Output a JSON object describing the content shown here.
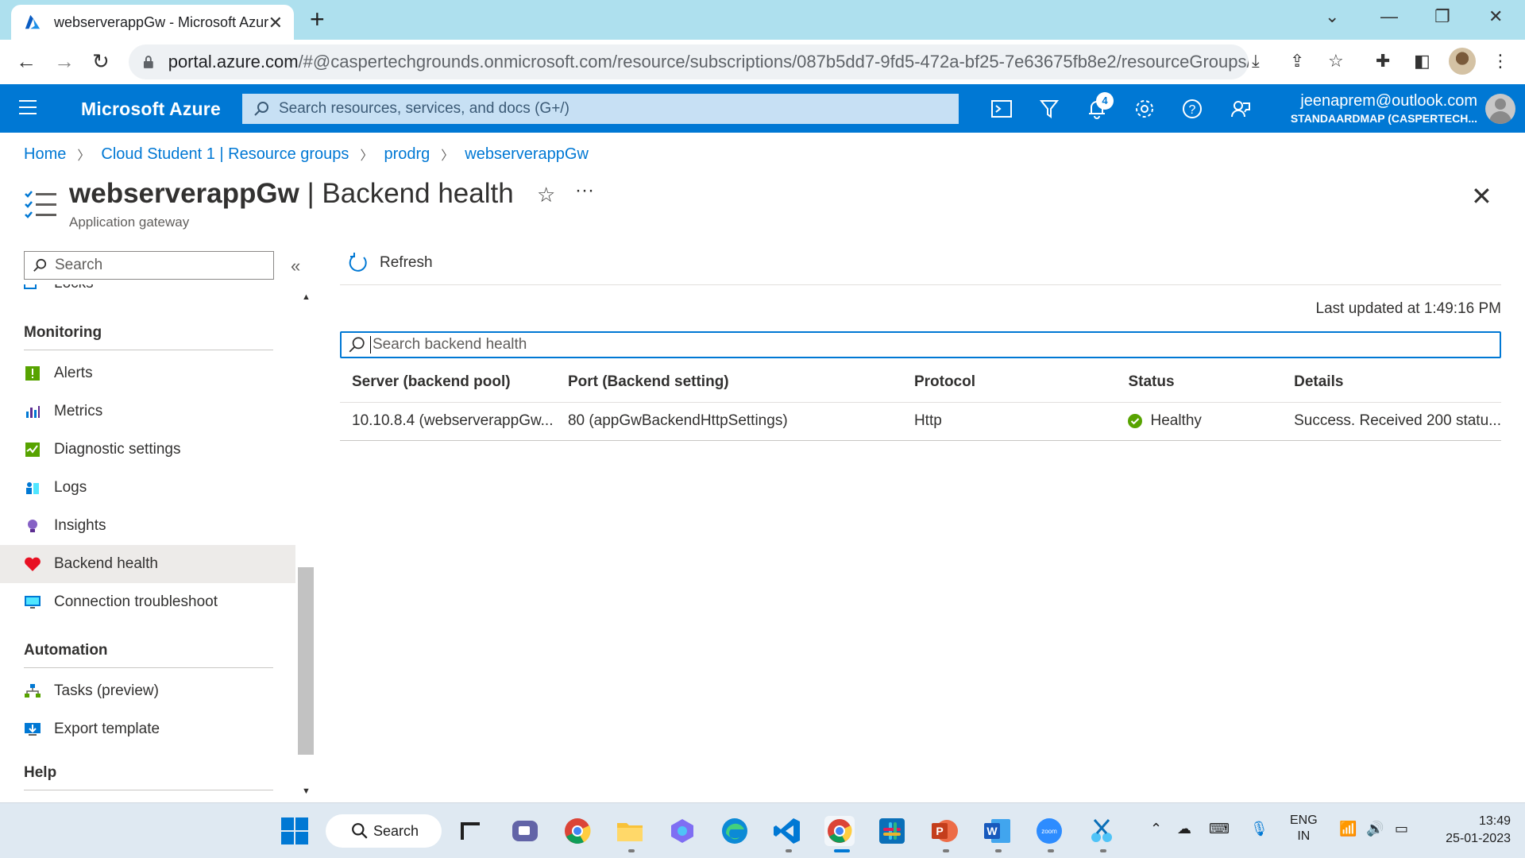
{
  "browser": {
    "tab_title": "webserverappGw - Microsoft Azure",
    "url_host": "portal.azure.com",
    "url_rest": "/#@caspertechgrounds.onmicrosoft.com/resource/subscriptions/087b5dd7-9fd5-472a-bf25-7e63675fb8e2/resourceGroups/pr..."
  },
  "azure": {
    "brand": "Microsoft Azure",
    "search_placeholder": "Search resources, services, and docs (G+/)",
    "notifications_count": "4",
    "user_email": "jeenaprem@outlook.com",
    "user_tenant": "STANDAARDMAP (CASPERTECH..."
  },
  "breadcrumb": [
    "Home",
    "Cloud Student 1 | Resource groups",
    "prodrg",
    "webserverappGw"
  ],
  "page": {
    "title_resource": "webserverappGw",
    "title_section": " | Backend health",
    "subtitle": "Application gateway"
  },
  "nav": {
    "search_placeholder": "Search",
    "partial_item": "Locks",
    "groups": {
      "monitoring": "Monitoring",
      "automation": "Automation",
      "help": "Help"
    },
    "items": [
      {
        "label": "Alerts",
        "icon": "alerts-icon"
      },
      {
        "label": "Metrics",
        "icon": "metrics-icon"
      },
      {
        "label": "Diagnostic settings",
        "icon": "diagnostic-settings-icon"
      },
      {
        "label": "Logs",
        "icon": "logs-icon"
      },
      {
        "label": "Insights",
        "icon": "insights-icon"
      },
      {
        "label": "Backend health",
        "icon": "heart-icon"
      },
      {
        "label": "Connection troubleshoot",
        "icon": "monitor-icon"
      },
      {
        "label": "Tasks (preview)",
        "icon": "tasks-icon"
      },
      {
        "label": "Export template",
        "icon": "export-template-icon"
      }
    ],
    "active_item": "Backend health"
  },
  "toolbar": {
    "refresh_label": "Refresh"
  },
  "content": {
    "last_updated": "Last updated at 1:49:16 PM",
    "search_placeholder": "Search backend health",
    "columns": [
      "Server (backend pool)",
      "Port (Backend setting)",
      "Protocol",
      "Status",
      "Details"
    ],
    "rows": [
      {
        "server": "10.10.8.4 (webserverappGw...",
        "port": "80 (appGwBackendHttpSettings)",
        "protocol": "Http",
        "status": "Healthy",
        "details": "Success. Received 200 statu..."
      }
    ]
  },
  "taskbar": {
    "search_label": "Search",
    "lang_line1": "ENG",
    "lang_line2": "IN",
    "time": "13:49",
    "date": "25-01-2023"
  },
  "colors": {
    "azure_blue": "#0078d4",
    "healthy_green": "#57a300"
  }
}
